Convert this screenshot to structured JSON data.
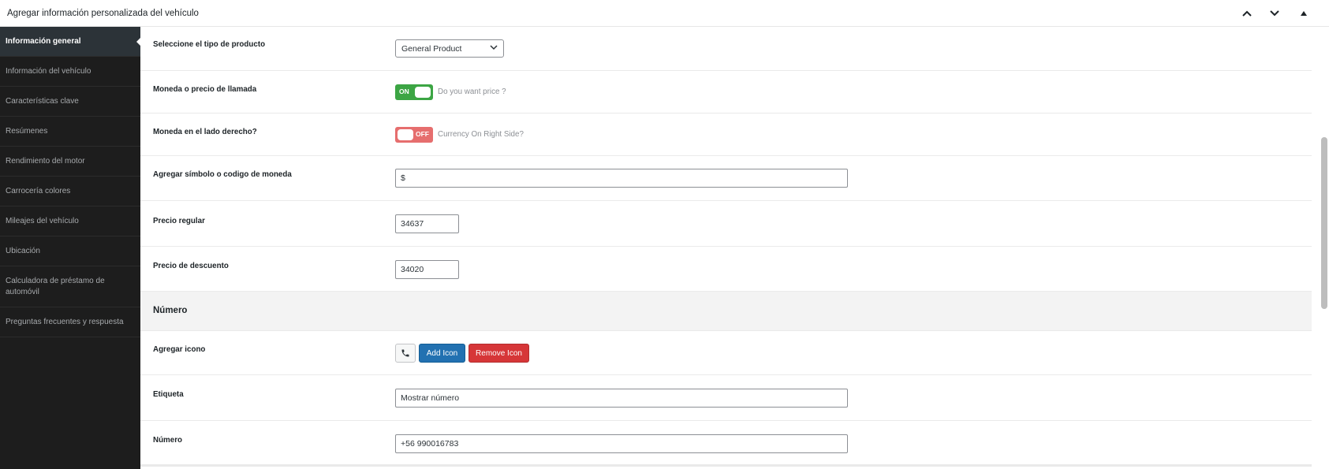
{
  "panel": {
    "title": "Agregar información personalizada del vehículo",
    "controls": [
      "chevron-up-icon",
      "chevron-down-icon",
      "collapse-triangle-icon"
    ]
  },
  "sidebar": {
    "items": [
      {
        "label": "Información general",
        "active": true
      },
      {
        "label": "Información del vehículo"
      },
      {
        "label": "Características clave"
      },
      {
        "label": "Resúmenes"
      },
      {
        "label": "Rendimiento del motor"
      },
      {
        "label": "Carrocería colores"
      },
      {
        "label": "Mileajes del vehículo"
      },
      {
        "label": "Ubicación"
      },
      {
        "label": "Calculadora de préstamo de automóvil"
      },
      {
        "label": "Preguntas frecuentes y respuesta"
      }
    ]
  },
  "form": {
    "product_type": {
      "label": "Seleccione el tipo de producto",
      "value": "General Product"
    },
    "call_price": {
      "label": "Moneda o precio de llamada",
      "toggle": "ON",
      "hint": "Do you want price ?"
    },
    "currency_right": {
      "label": "Moneda en el lado derecho?",
      "toggle": "OFF",
      "hint": "Currency On Right Side?"
    },
    "currency_symbol": {
      "label": "Agregar símbolo o codigo de moneda",
      "value": "$"
    },
    "regular_price": {
      "label": "Precio regular",
      "value": "34637"
    },
    "discount_price": {
      "label": "Precio de descuento",
      "value": "34020"
    },
    "section_number": {
      "label": "Número"
    },
    "add_icon": {
      "label": "Agregar icono",
      "icon": "phone-icon",
      "add_label": "Add Icon",
      "remove_label": "Remove Icon"
    },
    "tag": {
      "label": "Etiqueta",
      "value": "Mostrar número"
    },
    "number": {
      "label": "Número",
      "value": "+56 990016783"
    }
  },
  "colors": {
    "sidebar_bg": "#1d1d1d",
    "toggle_on": "#3ca544",
    "toggle_off": "#e66e6e",
    "button_blue": "#2271b1",
    "button_red": "#d63638"
  }
}
